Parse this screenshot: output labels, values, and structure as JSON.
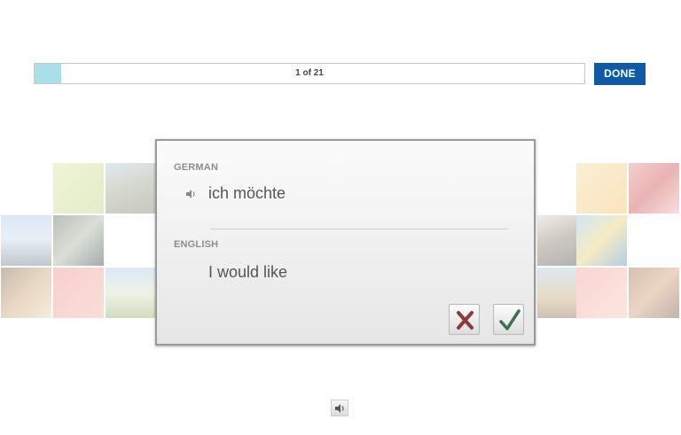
{
  "progress": {
    "label": "1 of 21",
    "current": 1,
    "total": 21
  },
  "done_label": "DONE",
  "card": {
    "source_language": "GERMAN",
    "source_word": "ich möchte",
    "target_language": "ENGLISH",
    "target_word": "I would like"
  },
  "colors": {
    "progress_fill": "#a9dfe9",
    "done_button": "#0f5aa6",
    "wrong_mark": "#8f3a3a",
    "right_mark": "#3f6f4f"
  },
  "icons": {
    "word_audio": "speaker-icon",
    "page_audio": "speaker-icon",
    "wrong": "cross-icon",
    "right": "check-icon"
  }
}
